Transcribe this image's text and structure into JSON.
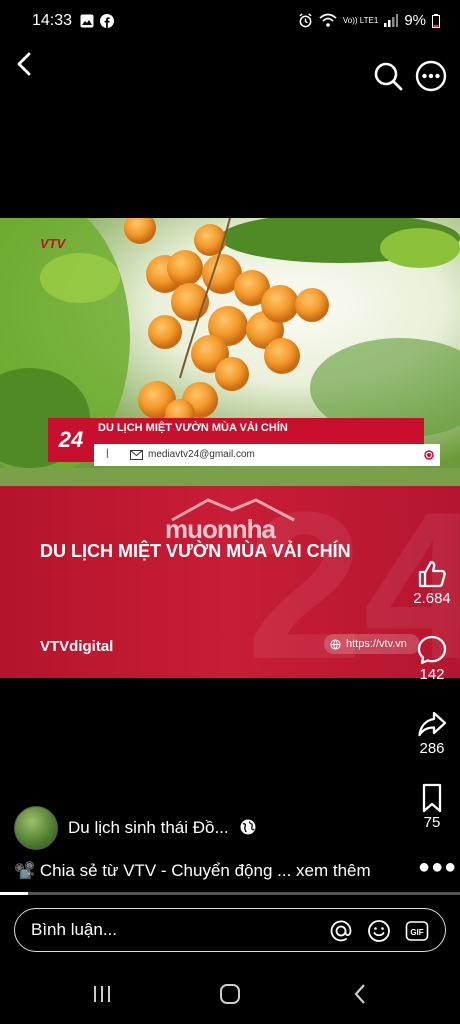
{
  "status_bar": {
    "time": "14:33",
    "network": "Vo)) LTE1",
    "battery": "9%"
  },
  "video": {
    "channel_logo": "VTV",
    "ticker_number": "24",
    "ticker_title": "DU LỊCH MIỆT VƯỜN MÙA VẢI CHÍN",
    "ticker_email": "mediavtv24@gmail.com",
    "ticker_separator": "|",
    "watermark": "muonnha",
    "panel_title": "DU LỊCH MIỆT VƯỜN MÙA VẢI CHÍN",
    "brand": "VTVdigital",
    "url": "https://vtv.vn"
  },
  "actions": {
    "likes": "2.684",
    "comments": "142",
    "shares": "286",
    "saves": "75"
  },
  "post": {
    "page_name": "Du lịch sinh thái Đồ...",
    "description": "Chia sẻ từ VTV - Chuyển động ...",
    "see_more": "xem thêm",
    "progress": 0.06
  },
  "comment_box": {
    "placeholder": "Bình luận..."
  },
  "icons": [
    "back-icon",
    "search-icon",
    "more-icon",
    "like-icon",
    "comment-icon",
    "share-icon",
    "bookmark-icon",
    "globe-icon",
    "mention-icon",
    "emoji-icon",
    "gif-icon"
  ]
}
